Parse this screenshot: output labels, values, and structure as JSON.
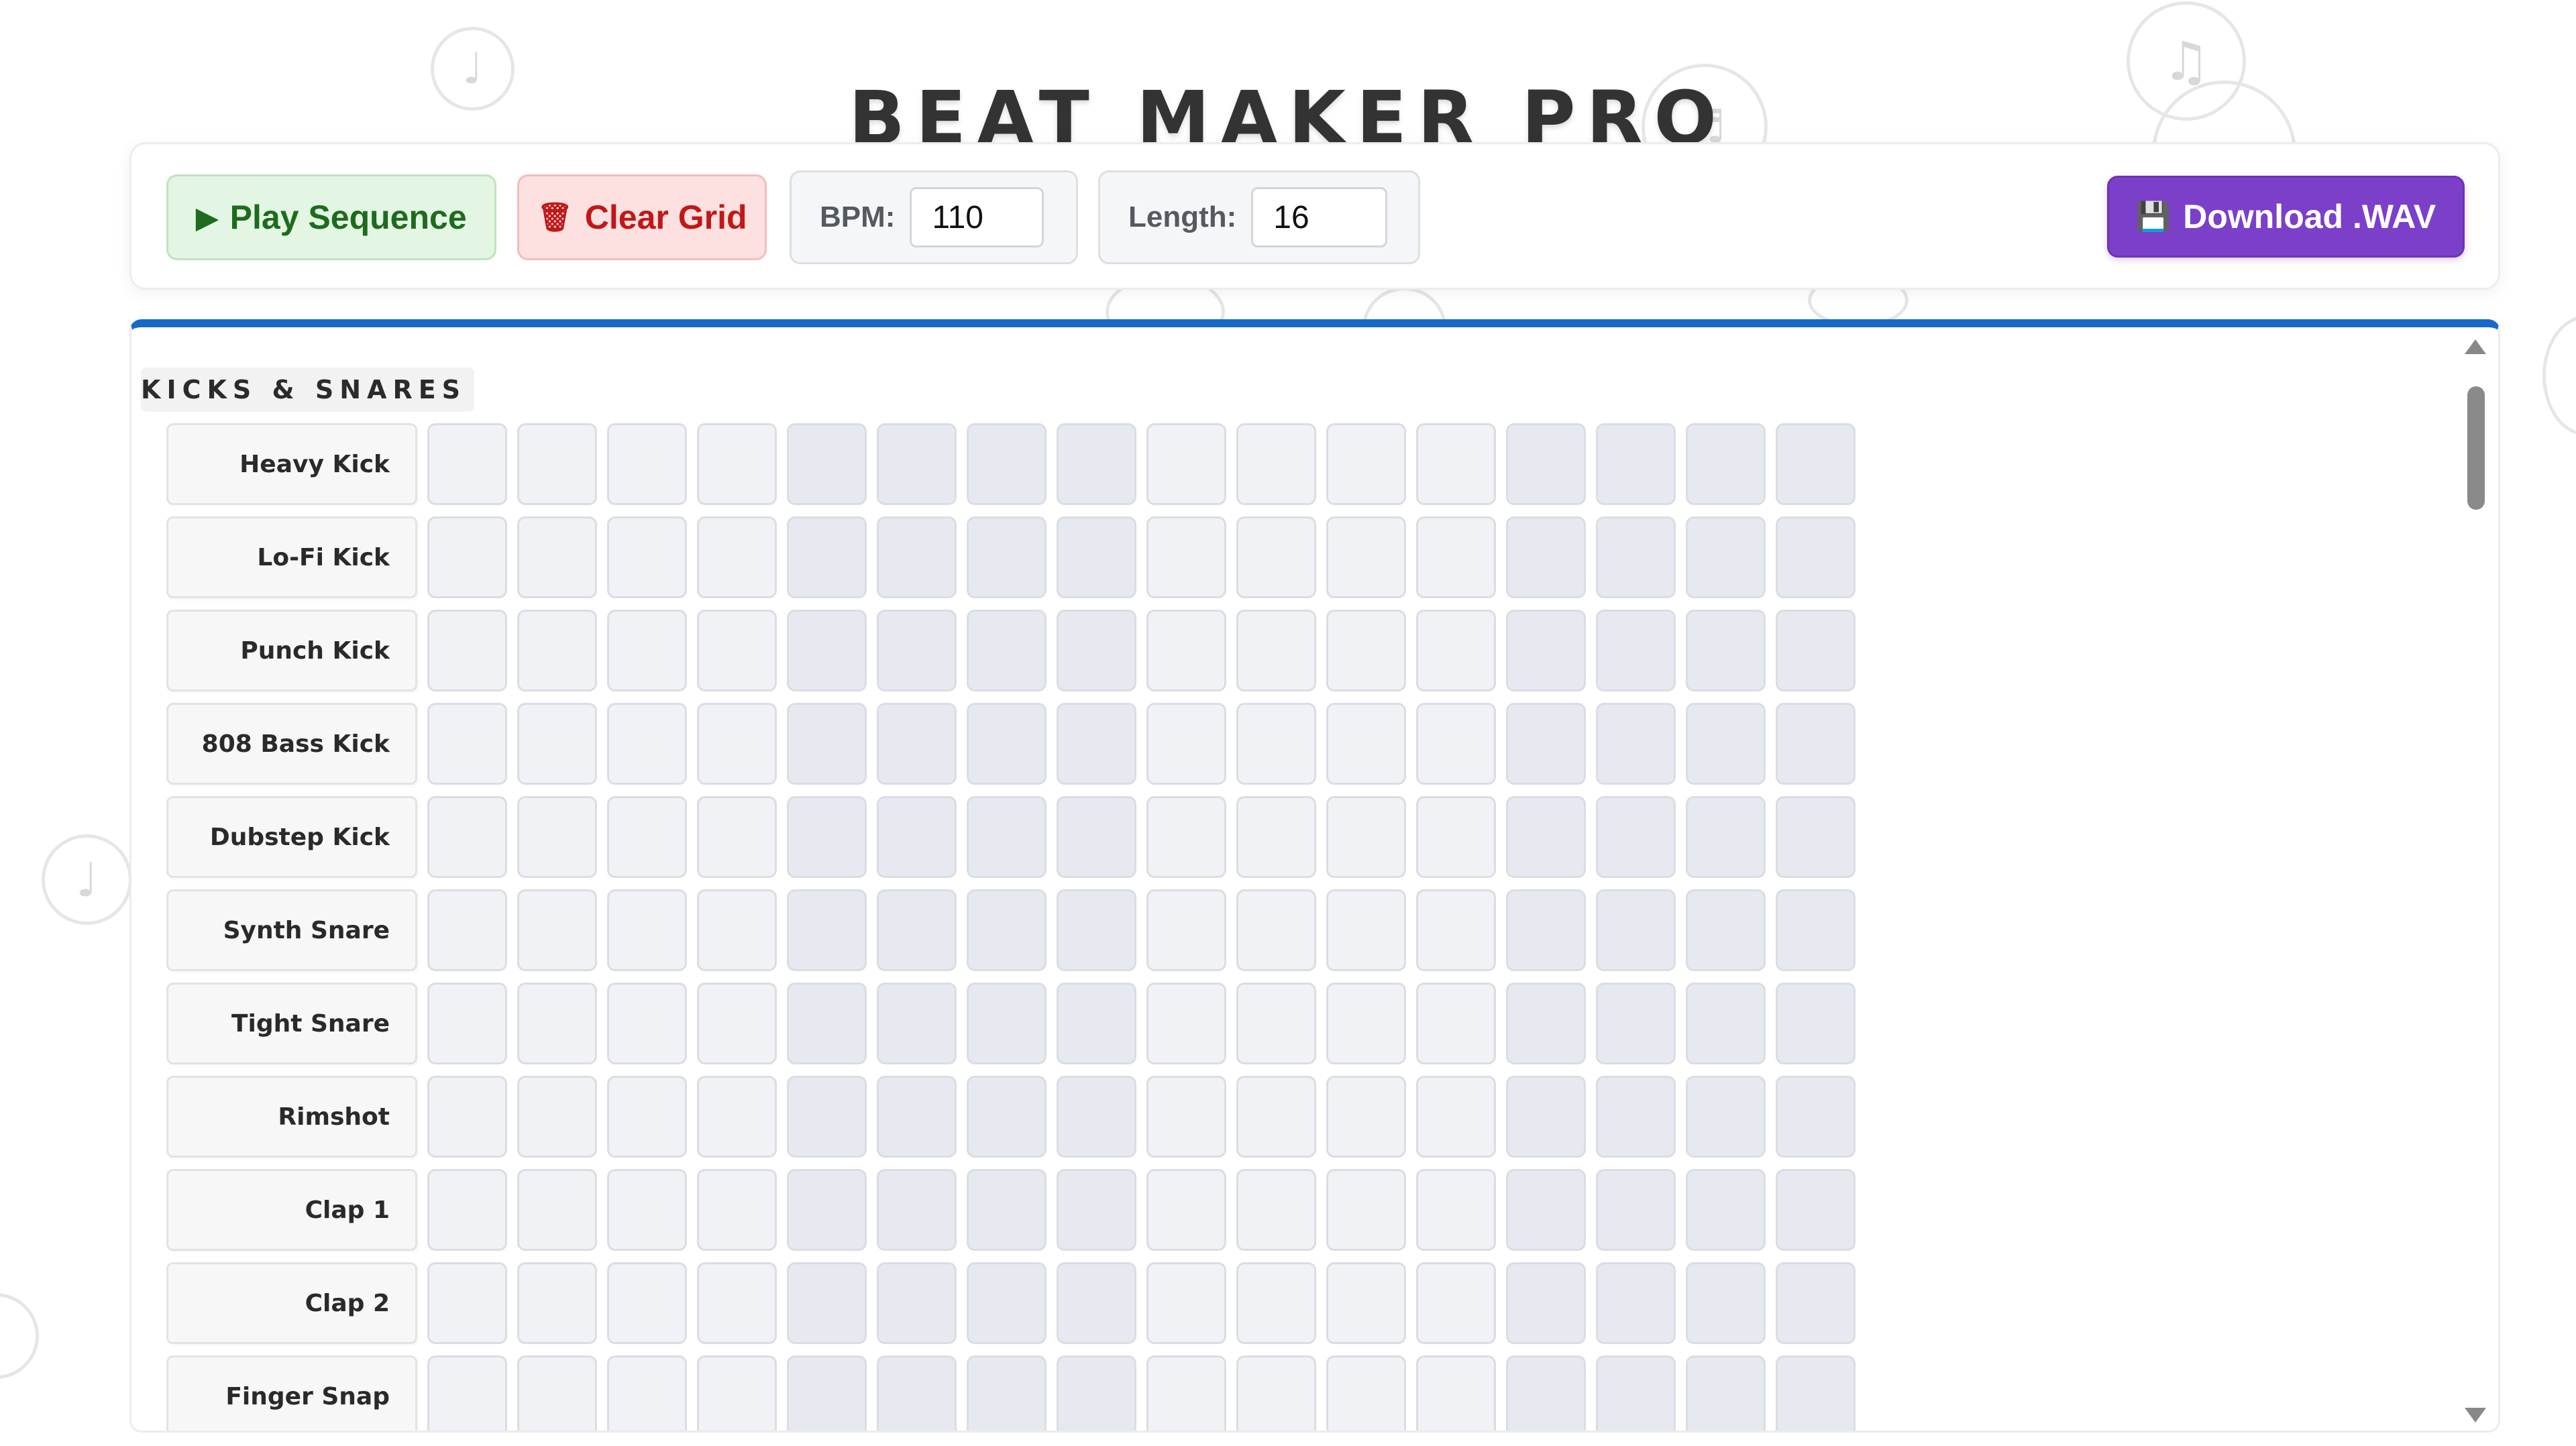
{
  "app": {
    "title": "BEAT MAKER PRO"
  },
  "toolbar": {
    "play_label": "Play Sequence",
    "play_icon": "▶",
    "clear_label": "Clear Grid",
    "clear_icon": "🗑",
    "bpm_label": "BPM:",
    "bpm_value": "110",
    "length_label": "Length:",
    "length_value": "16",
    "download_label": "Download .WAV",
    "download_icon": "💾"
  },
  "sequencer": {
    "section_label": "KICKS & SNARES",
    "steps": 16,
    "rows": [
      {
        "label": "Heavy Kick"
      },
      {
        "label": "Lo-Fi Kick"
      },
      {
        "label": "Punch Kick"
      },
      {
        "label": "808 Bass Kick"
      },
      {
        "label": "Dubstep Kick"
      },
      {
        "label": "Synth Snare"
      },
      {
        "label": "Tight Snare"
      },
      {
        "label": "Rimshot"
      },
      {
        "label": "Clap 1"
      },
      {
        "label": "Clap 2"
      },
      {
        "label": "Finger Snap"
      }
    ]
  },
  "colors": {
    "accent_blue": "#1769c9",
    "play_green": "#1e6b1e",
    "clear_red": "#c01818",
    "download_purple": "#7b3fc9"
  },
  "decor": {
    "note_glyph_1": "♩",
    "note_glyph_2": "♬",
    "note_glyph_3": "♫"
  }
}
